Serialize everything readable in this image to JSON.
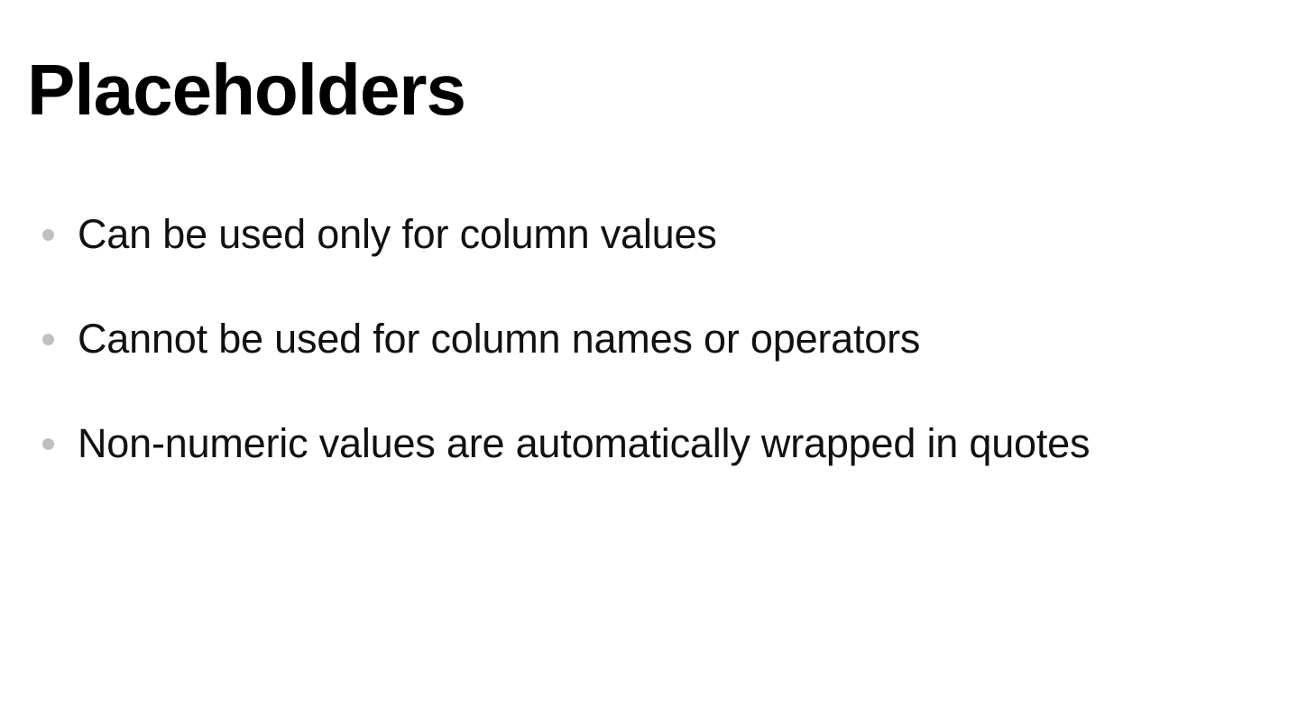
{
  "slide": {
    "title": "Placeholders",
    "bullets": [
      "Can be used only for column values",
      "Cannot be used for column names or operators",
      "Non-numeric values are automatically wrapped in quotes"
    ]
  }
}
